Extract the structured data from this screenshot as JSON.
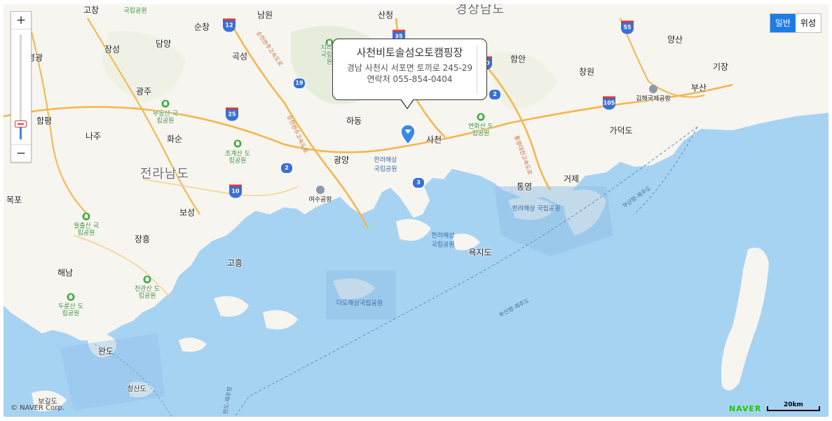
{
  "map": {
    "zoom": {
      "plus": "+",
      "minus": "−",
      "level": 0.15
    },
    "map_types": [
      {
        "label": "일반",
        "active": true
      },
      {
        "label": "위성",
        "active": false
      }
    ],
    "popup": {
      "title": "사천비토솔섬오토캠핑장",
      "address": "경남 사천시 서포면 토끼로 245-29",
      "phone": "연락처 055-854-0404"
    },
    "copyright": "© NAVER Corp.",
    "logo": "NAVER",
    "scale": "20km",
    "provinces": [
      "경상남도",
      "전라남도"
    ],
    "cities": [
      "고창",
      "남원",
      "산청",
      "양산",
      "장성",
      "담양",
      "순창",
      "곡성",
      "함안",
      "영광",
      "광주",
      "창원",
      "기장",
      "부산",
      "함평",
      "하동",
      "사천",
      "나주",
      "화순",
      "가덕도",
      "광양",
      "통영",
      "거제",
      "목포",
      "보성",
      "장흥",
      "고흥",
      "욕지도",
      "해남",
      "완도",
      "청산도",
      "보길도"
    ],
    "parks": [
      "국립공원",
      "지리산 국립공원",
      "무등산 국립공원",
      "연화산 도립공원",
      "조계산 도립공원",
      "한려해상 국립공원",
      "월출산 국립공원",
      "천관산 도립공원",
      "두륜산 도립공원",
      "한려해상 국립공원",
      "한려해상 국립공원",
      "다도해상국립공원"
    ],
    "airports": [
      "여수공항",
      "김해국제공항"
    ],
    "routes": [
      "12",
      "35",
      "55",
      "19",
      "10",
      "2",
      "25",
      "2",
      "10",
      "105",
      "3"
    ],
    "ferry_lines": [
      "부산항-제주도",
      "부산항-제주도",
      "완도-제주항"
    ],
    "road_labels": [
      "순천완주고속도로",
      "순천완주고속도로",
      "통영대전고속도로"
    ],
    "colors": {
      "sea": "#a7d3f3",
      "land": "#f6f5ef",
      "accent": "#1f7ce6",
      "marker": "#3a88e6",
      "park": "#45a845"
    }
  }
}
